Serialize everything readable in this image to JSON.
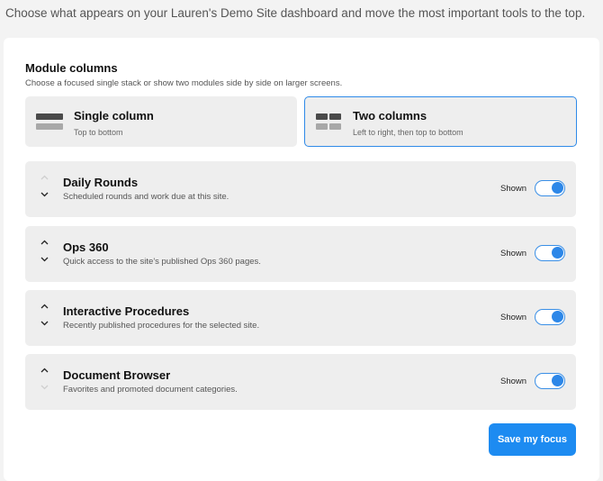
{
  "header": {
    "intro_text": "Choose what appears on your Lauren's Demo Site dashboard and move the most important tools to the top."
  },
  "module_columns": {
    "title": "Module columns",
    "subtitle": "Choose a focused single stack or show two modules side by side on larger screens.",
    "options": [
      {
        "label": "Single column",
        "description": "Top to bottom",
        "selected": false,
        "icon": "single-column-layout-icon"
      },
      {
        "label": "Two columns",
        "description": "Left to right, then top to bottom",
        "selected": true,
        "icon": "two-column-layout-icon"
      }
    ]
  },
  "modules": [
    {
      "title": "Daily Rounds",
      "description": "Scheduled rounds and work due at this site.",
      "status": "Shown",
      "enabled": true,
      "up_enabled": false,
      "down_enabled": true
    },
    {
      "title": "Ops 360",
      "description": "Quick access to the site's published Ops 360 pages.",
      "status": "Shown",
      "enabled": true,
      "up_enabled": true,
      "down_enabled": true
    },
    {
      "title": "Interactive Procedures",
      "description": "Recently published procedures for the selected site.",
      "status": "Shown",
      "enabled": true,
      "up_enabled": true,
      "down_enabled": true
    },
    {
      "title": "Document Browser",
      "description": "Favorites and promoted document categories.",
      "status": "Shown",
      "enabled": true,
      "up_enabled": true,
      "down_enabled": false
    }
  ],
  "actions": {
    "save_label": "Save my focus"
  },
  "colors": {
    "accent": "#1d8bf1",
    "selected_border": "#2f8ae8",
    "card_background": "#eeeeee"
  }
}
